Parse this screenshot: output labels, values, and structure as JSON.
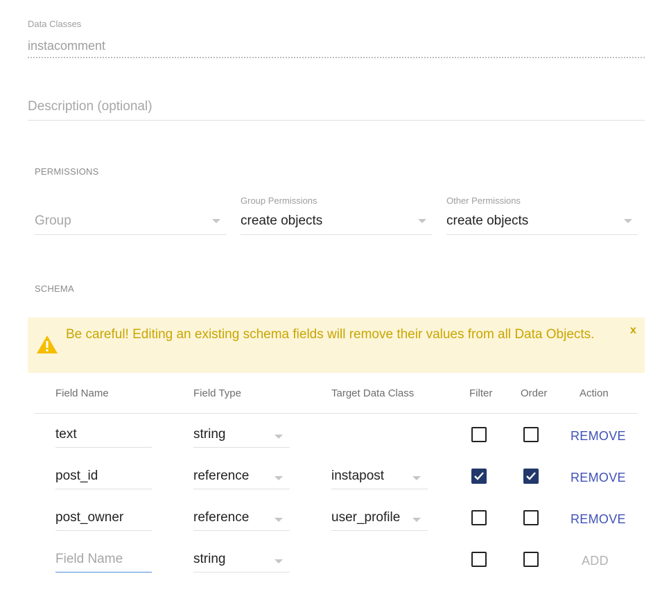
{
  "data_class": {
    "label": "Data Classes",
    "value": "instacomment"
  },
  "description": {
    "placeholder": "Description (optional)"
  },
  "permissions": {
    "heading": "PERMISSIONS",
    "group": {
      "label": "",
      "value": "Group"
    },
    "group_permissions": {
      "label": "Group Permissions",
      "value": "create objects"
    },
    "other_permissions": {
      "label": "Other Permissions",
      "value": "create objects"
    }
  },
  "schema": {
    "heading": "SCHEMA",
    "warning": {
      "text": "Be careful! Editing an existing schema fields will remove their values from all Data Objects.",
      "close_label": "x",
      "icon": "warning-triangle-icon",
      "color": "#c9a500",
      "background": "#fcf5d8"
    },
    "columns": {
      "field_name": "Field Name",
      "field_type": "Field Type",
      "target": "Target Data Class",
      "filter": "Filter",
      "order": "Order",
      "action": "Action"
    },
    "rows": [
      {
        "field_name": "text",
        "field_type": "string",
        "target": "",
        "filter": false,
        "order": false,
        "action": "REMOVE"
      },
      {
        "field_name": "post_id",
        "field_type": "reference",
        "target": "instapost",
        "filter": true,
        "order": true,
        "action": "REMOVE"
      },
      {
        "field_name": "post_owner",
        "field_type": "reference",
        "target": "user_profile",
        "filter": false,
        "order": false,
        "action": "REMOVE"
      }
    ],
    "new_row": {
      "field_name_placeholder": "Field Name",
      "field_type": "string",
      "filter": false,
      "order": false,
      "action": "ADD"
    }
  },
  "colors": {
    "accent": "#3f51b5",
    "checked": "#22386b",
    "focus": "#4a90d9"
  }
}
